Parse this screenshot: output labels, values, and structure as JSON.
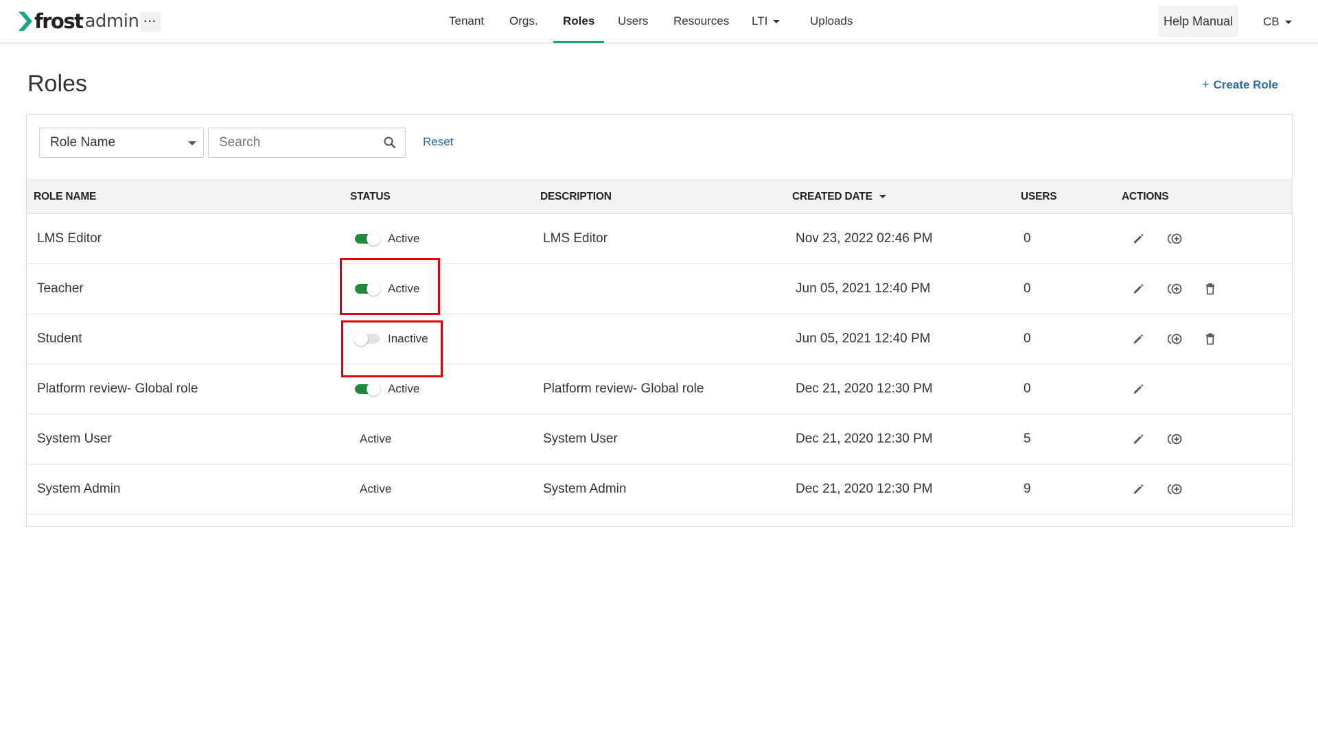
{
  "app": {
    "brand": "frost",
    "brand_sub": "admin",
    "more_label": "···"
  },
  "nav": {
    "items": [
      {
        "label": "Tenant"
      },
      {
        "label": "Orgs."
      },
      {
        "label": "Roles",
        "active": true
      },
      {
        "label": "Users"
      },
      {
        "label": "Resources"
      },
      {
        "label": "LTI",
        "has_dropdown": true
      },
      {
        "label": "Uploads"
      }
    ],
    "help_label": "Help Manual",
    "user_label": "CB"
  },
  "page": {
    "title": "Roles",
    "create_label": "Create Role",
    "create_icon": "+"
  },
  "filter": {
    "selected": "Role Name",
    "search_placeholder": "Search",
    "reset_label": "Reset"
  },
  "table": {
    "headers": {
      "role_name": "ROLE NAME",
      "status": "STATUS",
      "description": "DESCRIPTION",
      "created_date": "CREATED DATE",
      "users": "USERS",
      "actions": "ACTIONS"
    },
    "sort_column": "created_date",
    "sort_direction": "desc",
    "rows": [
      {
        "name": "LMS Editor",
        "status": "Active",
        "toggle": "on",
        "description": "LMS Editor",
        "created": "Nov 23, 2022 02:46 PM",
        "users": "0",
        "actions": [
          "pencil-icon",
          "copy-icon"
        ]
      },
      {
        "name": "Teacher",
        "status": "Active",
        "toggle": "on",
        "description": "",
        "created": "Jun 05, 2021 12:40 PM",
        "users": "0",
        "actions": [
          "pencil-icon",
          "copy-icon",
          "trash-icon"
        ]
      },
      {
        "name": "Student",
        "status": "Inactive",
        "toggle": "off",
        "description": "",
        "created": "Jun 05, 2021 12:40 PM",
        "users": "0",
        "actions": [
          "pencil-icon",
          "copy-icon",
          "trash-icon"
        ]
      },
      {
        "name": "Platform review- Global role",
        "status": "Active",
        "toggle": "on",
        "description": "Platform review- Global role",
        "created": "Dec 21, 2020 12:30 PM",
        "users": "0",
        "actions": [
          "pencil-icon"
        ]
      },
      {
        "name": "System User",
        "status": "Active",
        "toggle": "none",
        "description": "System User",
        "created": "Dec 21, 2020 12:30 PM",
        "users": "5",
        "actions": [
          "pencil-icon",
          "copy-icon"
        ]
      },
      {
        "name": "System Admin",
        "status": "Active",
        "toggle": "none",
        "description": "System Admin",
        "created": "Dec 21, 2020 12:30 PM",
        "users": "9",
        "actions": [
          "pencil-icon",
          "copy-icon"
        ]
      }
    ]
  },
  "colors": {
    "accent": "#1aa58a",
    "link": "#2c6aa8",
    "toggle_on": "#1f8a3a",
    "highlight": "#e0000c"
  }
}
